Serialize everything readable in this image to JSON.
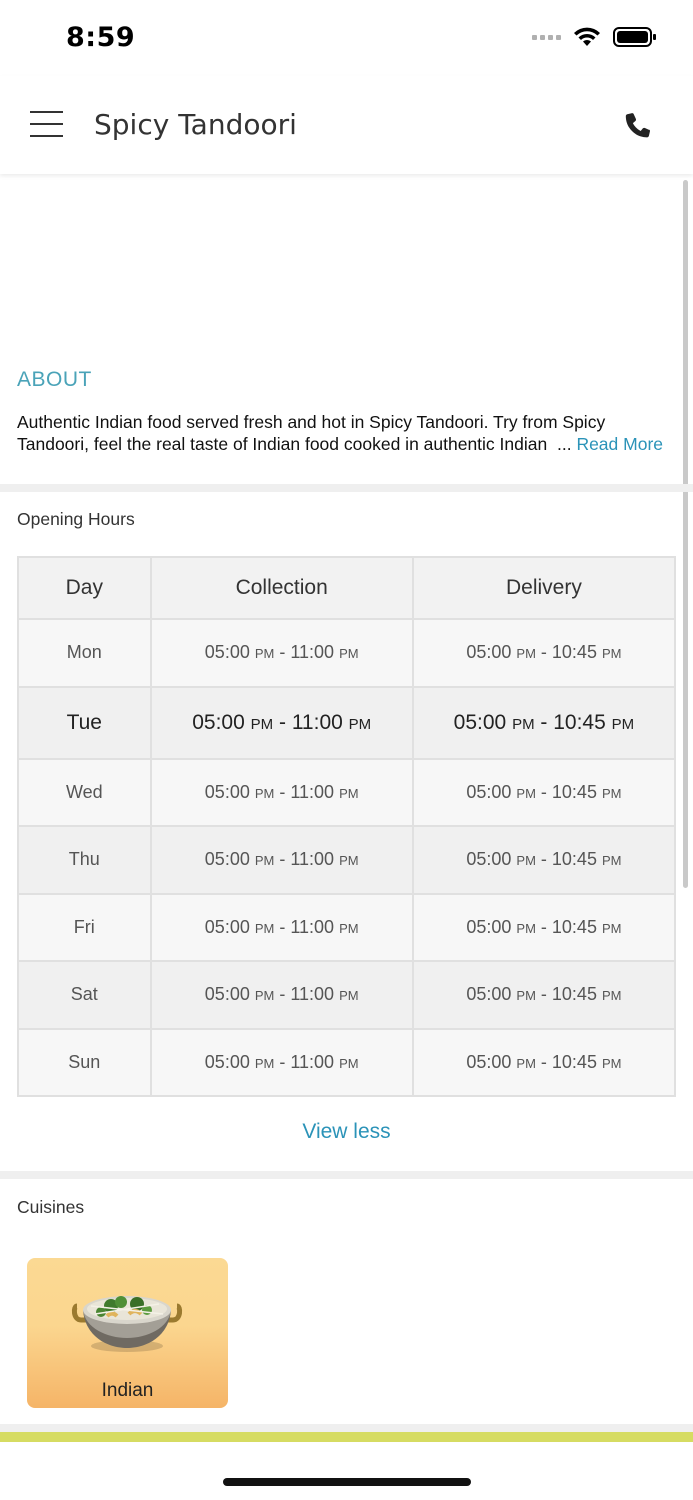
{
  "status_bar": {
    "time": "8:59"
  },
  "header": {
    "title": "Spicy Tandoori"
  },
  "about": {
    "heading": "ABOUT",
    "line1": "Authentic Indian food served fresh and hot in Spicy Tandoori. Try from Spicy",
    "line2": "Tandoori, feel the real taste of Indian food cooked in authentic Indian",
    "ellipsis": "...",
    "read_more": "Read More"
  },
  "opening_hours": {
    "title": "Opening Hours",
    "headers": [
      "Day",
      "Collection",
      "Delivery"
    ],
    "rows": [
      {
        "day": "Mon",
        "c_start": "05:00",
        "c_start_ampm": "PM",
        "c_end": "11:00",
        "c_end_ampm": "PM",
        "d_start": "05:00",
        "d_start_ampm": "PM",
        "d_end": "10:45",
        "d_end_ampm": "PM"
      },
      {
        "day": "Tue",
        "c_start": "05:00",
        "c_start_ampm": "PM",
        "c_end": "11:00",
        "c_end_ampm": "PM",
        "d_start": "05:00",
        "d_start_ampm": "PM",
        "d_end": "10:45",
        "d_end_ampm": "PM"
      },
      {
        "day": "Wed",
        "c_start": "05:00",
        "c_start_ampm": "PM",
        "c_end": "11:00",
        "c_end_ampm": "PM",
        "d_start": "05:00",
        "d_start_ampm": "PM",
        "d_end": "10:45",
        "d_end_ampm": "PM"
      },
      {
        "day": "Thu",
        "c_start": "05:00",
        "c_start_ampm": "PM",
        "c_end": "11:00",
        "c_end_ampm": "PM",
        "d_start": "05:00",
        "d_start_ampm": "PM",
        "d_end": "10:45",
        "d_end_ampm": "PM"
      },
      {
        "day": "Fri",
        "c_start": "05:00",
        "c_start_ampm": "PM",
        "c_end": "11:00",
        "c_end_ampm": "PM",
        "d_start": "05:00",
        "d_start_ampm": "PM",
        "d_end": "10:45",
        "d_end_ampm": "PM"
      },
      {
        "day": "Sat",
        "c_start": "05:00",
        "c_start_ampm": "PM",
        "c_end": "11:00",
        "c_end_ampm": "PM",
        "d_start": "05:00",
        "d_start_ampm": "PM",
        "d_end": "10:45",
        "d_end_ampm": "PM"
      },
      {
        "day": "Sun",
        "c_start": "05:00",
        "c_start_ampm": "PM",
        "c_end": "11:00",
        "c_end_ampm": "PM",
        "d_start": "05:00",
        "d_start_ampm": "PM",
        "d_end": "10:45",
        "d_end_ampm": "PM"
      }
    ],
    "today": "Tue",
    "view_less": "View less"
  },
  "cuisines": {
    "title": "Cuisines",
    "items": [
      {
        "label": "Indian",
        "icon": "indian-food-bowl-icon"
      }
    ]
  },
  "colors": {
    "accent": "#2b93b8",
    "about_heading": "#4aa3b8",
    "footer_bar": "#d6dc62",
    "cuisine_card_top": "#fbd993",
    "cuisine_card_bottom": "#f5b467"
  }
}
